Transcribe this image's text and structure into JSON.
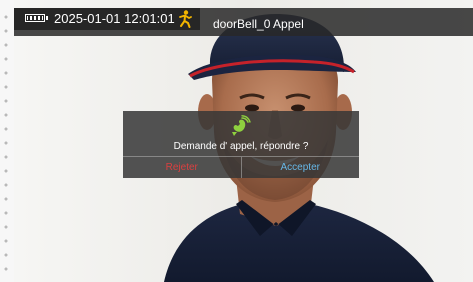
{
  "status_bar": {
    "datetime": "2025-01-01 12:01:01",
    "title": "doorBell_0 Appel",
    "battery_icon": "battery-icon",
    "person_icon": "person-walking-icon",
    "person_icon_color": "#f2b500"
  },
  "dialog": {
    "icon": "phone-ringing-icon",
    "icon_color": "#8fd13f",
    "message": "Demande d' appel, répondre ?",
    "reject_label": "Rejeter",
    "accept_label": "Accepter",
    "reject_color": "#d94040",
    "accept_color": "#66b8e8"
  },
  "video": {
    "description_icon": "doorbell-video-feed"
  }
}
